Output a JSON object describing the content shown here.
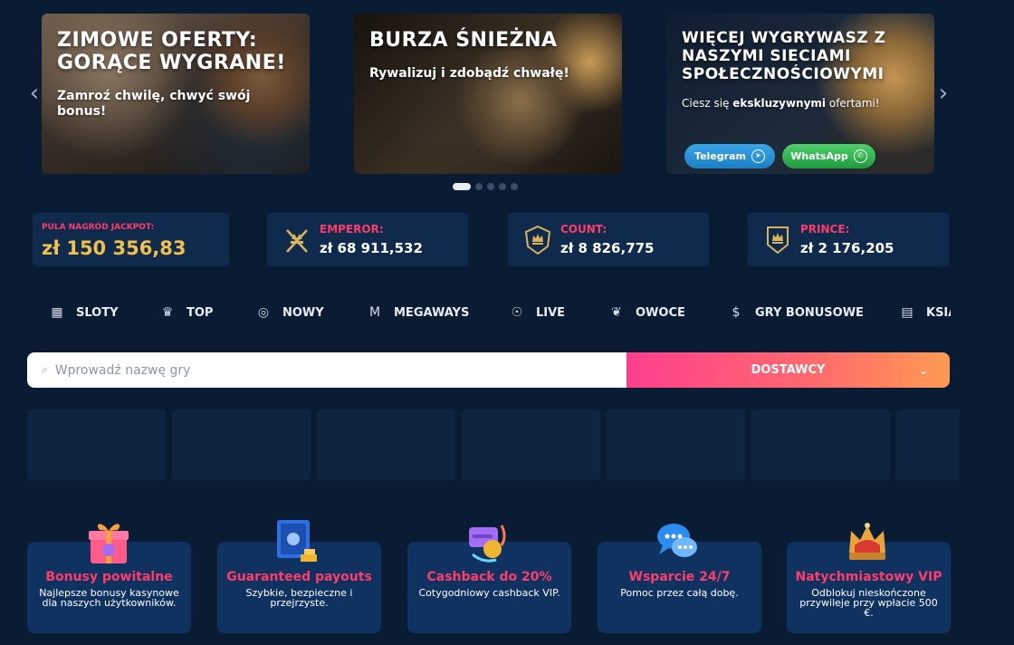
{
  "carousel": {
    "banners": [
      {
        "title": "ZIMOWE OFERTY: GORĄCE WYGRANE!",
        "subtitle": "Zamroź chwilę, chwyć swój bonus!"
      },
      {
        "title": "BURZA ŚNIEŻNA",
        "subtitle": "Rywalizuj i zdobądź chwałę!"
      },
      {
        "title": "WIĘCEJ WYGRYWASZ Z NASZYMI SIECIAMI SPOŁECZNOŚCIOWYMI",
        "subtitle_pre": "Ciesz się ",
        "subtitle_bold": "ekskluzywnymi",
        "subtitle_post": " ofertami!",
        "telegram_label": "Telegram",
        "whatsapp_label": "WhatsApp"
      }
    ],
    "prev_icon": "chevron-left-icon",
    "next_icon": "chevron-right-icon",
    "active_index": 0,
    "count": 5
  },
  "jackpot": {
    "main": {
      "label": "PULA NAGRÓD JACKPOT:",
      "value": "zł 150 356,83"
    },
    "tiers": [
      {
        "label": "EMPEROR:",
        "value": "zł 68 911,532",
        "icon": "crossed-swords-crown-icon"
      },
      {
        "label": "COUNT:",
        "value": "zł 8 826,775",
        "icon": "crown-shield-icon"
      },
      {
        "label": "PRINCE:",
        "value": "zł 2 176,205",
        "icon": "crown-shield-icon"
      }
    ]
  },
  "categories": [
    {
      "label": "SLOTY",
      "icon": "slot-machine-icon"
    },
    {
      "label": "TOP",
      "icon": "diamond-crown-icon"
    },
    {
      "label": "NOWY",
      "icon": "new-badge-icon"
    },
    {
      "label": "MEGAWAYS",
      "icon": "megaways-icon"
    },
    {
      "label": "LIVE",
      "icon": "live-dealer-icon"
    },
    {
      "label": "OWOCE",
      "icon": "cherries-icon"
    },
    {
      "label": "GRY BONUSOWE",
      "icon": "money-bag-icon"
    },
    {
      "label": "KSIĄŻKI",
      "icon": "book-icon"
    }
  ],
  "search": {
    "placeholder": "Wprowadź nazwę gry",
    "providers_label": "DOSTAWCY"
  },
  "features": [
    {
      "title": "Bonusy powitalne",
      "desc": "Najlepsze bonusy kasynowe dla naszych użytkowników.",
      "icon": "gift-icon"
    },
    {
      "title": "Guaranteed payouts",
      "desc": "Szybkie, bezpieczne i przejrzyste.",
      "icon": "safe-icon"
    },
    {
      "title": "Cashback do 20%",
      "desc": "Cotygodniowy cashback VIP.",
      "icon": "cashback-icon"
    },
    {
      "title": "Wsparcie 24/7",
      "desc": "Pomoc przez całą dobę.",
      "icon": "chat-bubbles-icon"
    },
    {
      "title": "Natychmiastowy VIP",
      "desc": "Odblokuj nieskończone przywileje przy wpłacie 500 €.",
      "icon": "crown-icon"
    }
  ],
  "colors": {
    "accent": "#ff3d6a",
    "gold": "#f0c14b",
    "panel": "#0f2a4d",
    "background": "#0a1c33"
  }
}
